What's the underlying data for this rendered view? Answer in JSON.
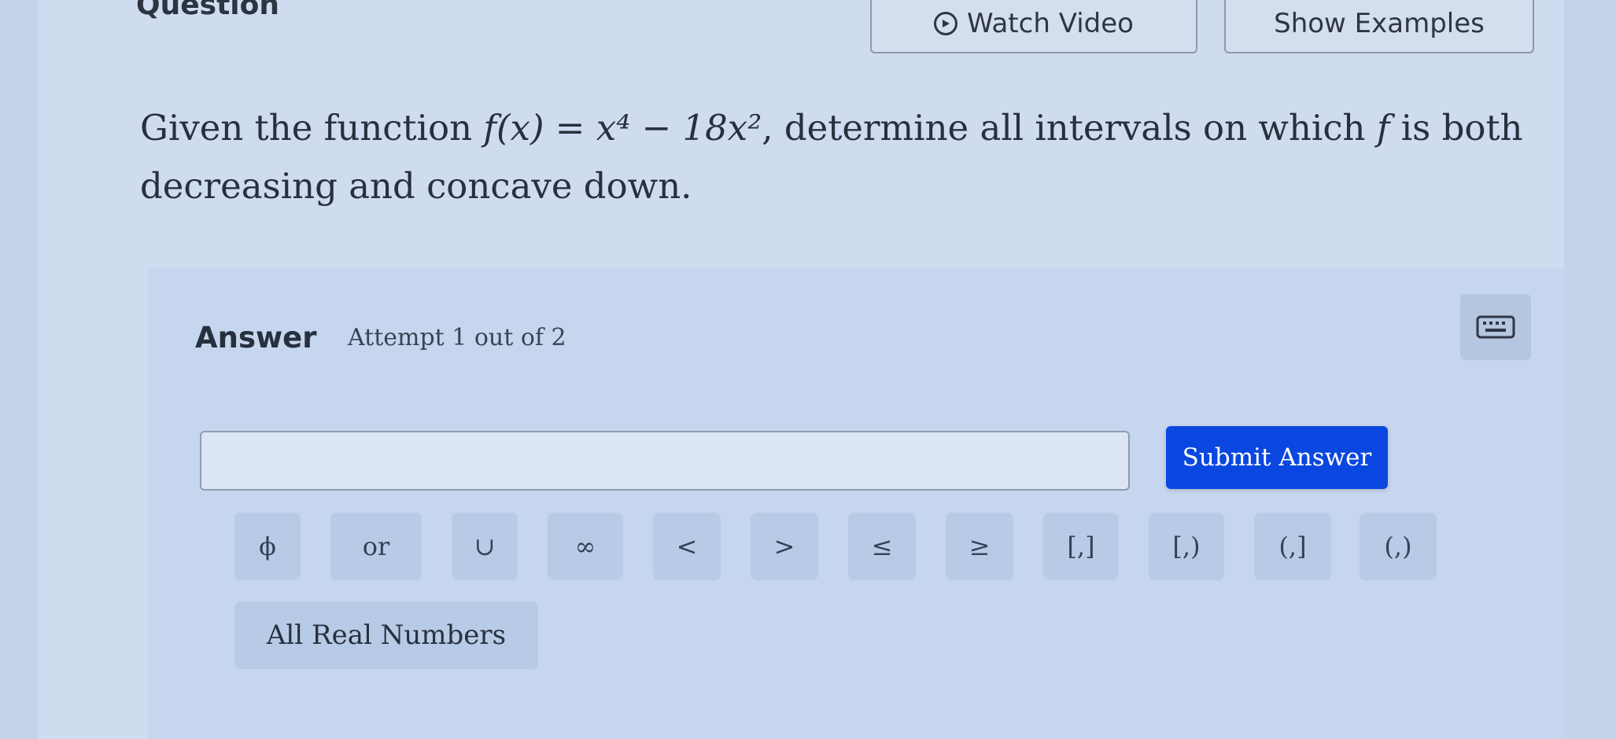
{
  "header": {
    "title": "Question",
    "watch_video_label": "Watch Video",
    "show_examples_label": "Show Examples"
  },
  "question": {
    "line1_pre": "Given the function ",
    "function_math": "f(x) = x⁴ − 18x²",
    "line1_post": ", determine all intervals on which ",
    "f_symbol": "f",
    "line1_end": " is both",
    "line2": "decreasing and concave down."
  },
  "answer": {
    "label": "Answer",
    "attempt": "Attempt 1 out of 2",
    "input_value": "",
    "submit_label": "Submit Answer",
    "keyboard_icon": "keyboard-icon"
  },
  "symbols": [
    "ϕ",
    "or",
    "∪",
    "∞",
    "<",
    ">",
    "≤",
    "≥",
    "[,]",
    "[,)",
    "(,]",
    "(,)"
  ],
  "all_real_label": "All Real Numbers",
  "colors": {
    "submit_bg": "#0a47e0",
    "symbol_button_bg": "#b8cbe6",
    "panel_bg": "#c6d6ee"
  }
}
